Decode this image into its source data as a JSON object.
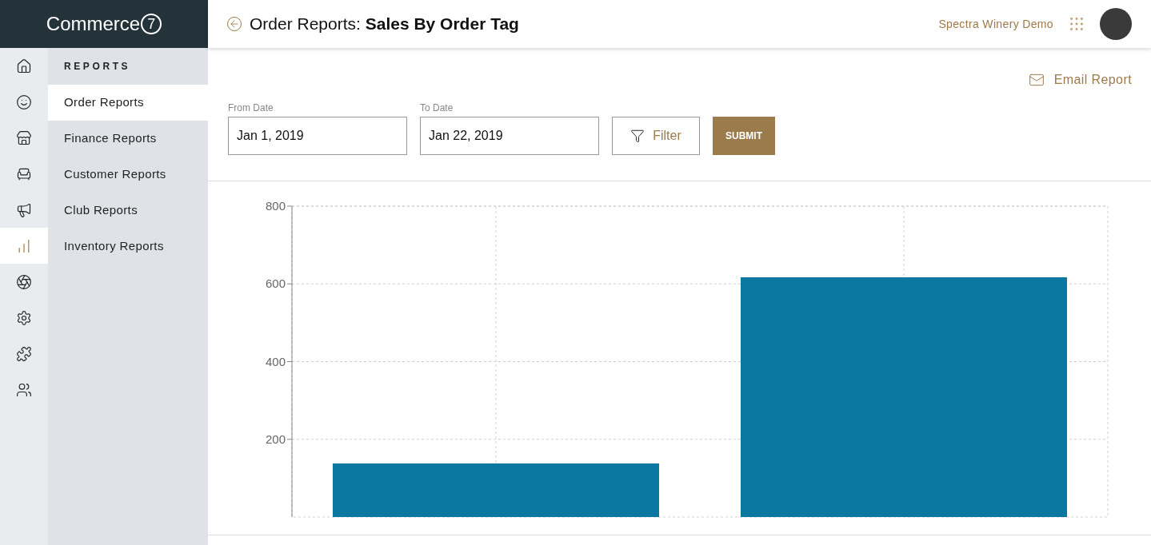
{
  "logo": {
    "text": "Commerce",
    "mark": "7"
  },
  "rail": [
    {
      "selected": false
    },
    {
      "selected": false
    },
    {
      "selected": false
    },
    {
      "selected": false
    },
    {
      "selected": false
    },
    {
      "selected": true
    },
    {
      "selected": false
    },
    {
      "selected": false
    },
    {
      "selected": false
    },
    {
      "selected": false
    }
  ],
  "submenu": {
    "heading": "REPORTS",
    "items": [
      {
        "label": "Order Reports",
        "selected": true
      },
      {
        "label": "Finance Reports",
        "selected": false
      },
      {
        "label": "Customer Reports",
        "selected": false
      },
      {
        "label": "Club Reports",
        "selected": false
      },
      {
        "label": "Inventory Reports",
        "selected": false
      }
    ]
  },
  "header": {
    "title": "Order Reports: **Sales By Order Tag**",
    "account": "Spectra Winery Demo"
  },
  "email_report": "Email Report",
  "filters": {
    "from_label": "From Date",
    "from_value": "Jan 1, 2019",
    "to_label": "To Date",
    "to_value": "Jan 22, 2019",
    "filter_button": "Filter",
    "submit_button": "SUBMIT"
  },
  "chart_data": {
    "type": "bar",
    "values": [
      138,
      617
    ],
    "ylim": [
      0,
      800
    ],
    "yticks": [
      200,
      400,
      600,
      800
    ],
    "grid": true
  }
}
